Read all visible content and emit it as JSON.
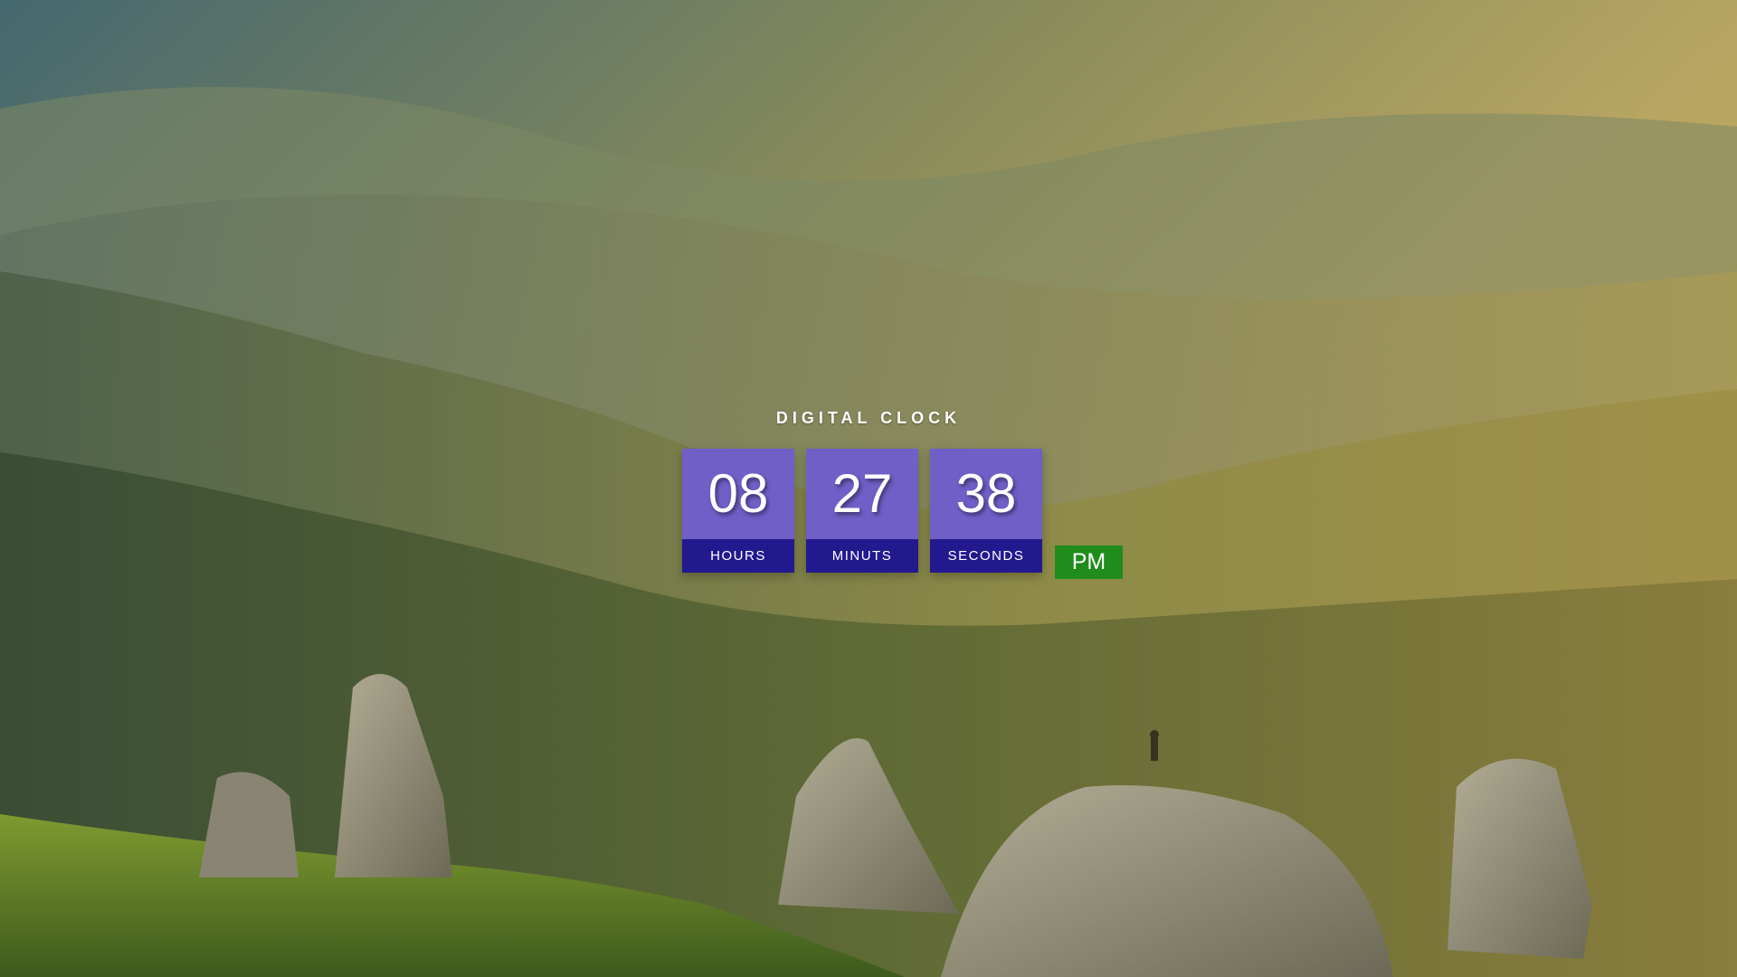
{
  "clock": {
    "title": "DIGITAL CLOCK",
    "hours": {
      "value": "08",
      "label": "HOURS"
    },
    "minutes": {
      "value": "27",
      "label": "MINUTS"
    },
    "seconds": {
      "value": "38",
      "label": "SECONDS"
    },
    "period": "PM"
  },
  "colors": {
    "digit_panel": "#6f5fc7",
    "label_panel": "#22198f",
    "period_badge": "#1f8c1c"
  },
  "background": {
    "description_icon": "mountain-landscape-image"
  }
}
